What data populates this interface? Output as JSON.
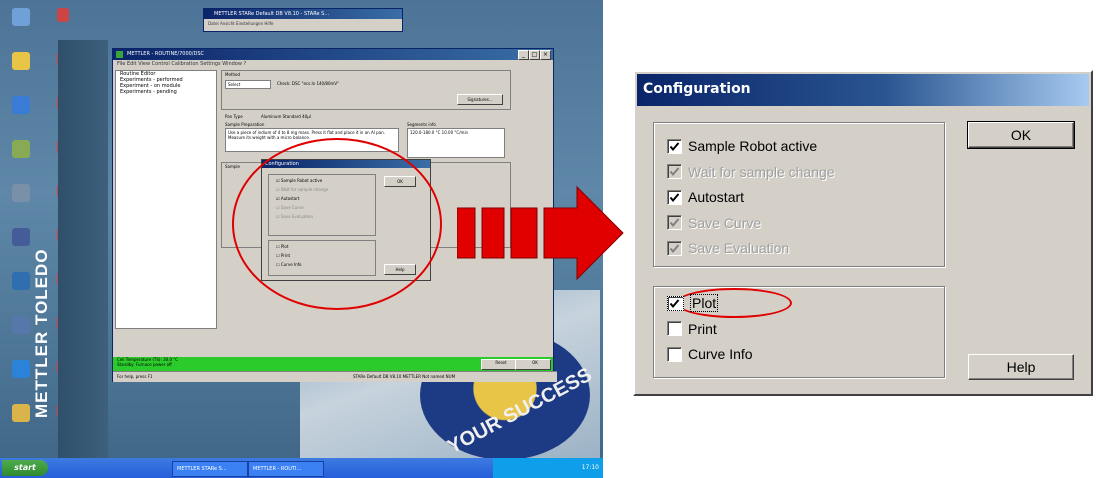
{
  "desktop": {
    "brand": "METTLER TOLEDO",
    "badge_text": "YOUR SUCCESS",
    "top_window_title": "METTLER STARe Default DB V8.10 - STARe S...",
    "top_window_menu": "Datei  Ansicht  Einstellungen  Hilfe",
    "app_title": "METTLER - ROUTINE/7000/DSC",
    "app_menu": "File  Edit  View  Control  Calibration  Settings  Window  ?",
    "routine_items": [
      "Routine Editor",
      "Experiments - performed",
      "Experiment - on module",
      "Experiments - pending"
    ],
    "method_label": "Method",
    "method_select": "Select",
    "check_text": "Check: DSC \"ecs.In 140/80mV\"",
    "signatures_button": "Signatures...",
    "pan_type_label": "Pan Type",
    "pan_type_value": "Aluminum Standard 40µl",
    "sample_prep_label": "Sample Preparation",
    "sample_prep_text": "Use a piece of indium of 4 to 8 mg mass. Press it flat and place it in an Al pan. Measure its weight with a micro balance.",
    "segments_label": "Segments info",
    "segments_text": "120.0-180.0 °C 10.00 °C/min",
    "sample_label": "Sample",
    "mini_dialog": {
      "title": "Configuration",
      "items": [
        "Sample Robot active",
        "Wait for sample change",
        "Autostart",
        "Save Curve",
        "Save Evaluation"
      ],
      "output_items": [
        "Plot",
        "Print",
        "Curve Info"
      ],
      "ok": "OK",
      "help": "Help"
    },
    "status_line1": "Cell Temperature (TS): 30.0 °C",
    "status_line2": "Standby: Furnace power off",
    "reset_button": "Reset",
    "ok_button": "OK",
    "statusbar_left": "For help, press F1",
    "statusbar_right": "STARe Default DB V8.10  METTLER  Not named  NUM",
    "start_label": "start",
    "taskbar_items": [
      "METTLER STARe S...",
      "METTLER - ROUTI..."
    ],
    "clock": "17:10",
    "icons": [
      "my-computer",
      "my-documents",
      "stare-software",
      "recycle-bin",
      "solution-center",
      "printer",
      "mt-director",
      "java-web-start",
      "internet-explorer",
      "folder"
    ]
  },
  "dialog": {
    "title": "Configuration",
    "options": [
      {
        "label": "Sample Robot active",
        "checked": true,
        "enabled": true
      },
      {
        "label": "Wait for sample change",
        "checked": true,
        "enabled": false
      },
      {
        "label": "Autostart",
        "checked": true,
        "enabled": true
      },
      {
        "label": "Save Curve",
        "checked": true,
        "enabled": false
      },
      {
        "label": "Save Evaluation",
        "checked": true,
        "enabled": false
      }
    ],
    "output": [
      {
        "label": "Plot",
        "checked": true,
        "enabled": true
      },
      {
        "label": "Print",
        "checked": false,
        "enabled": true
      },
      {
        "label": "Curve Info",
        "checked": false,
        "enabled": true
      }
    ],
    "ok_label": "OK",
    "help_label": "Help"
  },
  "colors": {
    "highlight": "#e00000",
    "titlebar_start": "#0a246a",
    "titlebar_end": "#a6caf0",
    "dialog_face": "#d4d0c8"
  }
}
